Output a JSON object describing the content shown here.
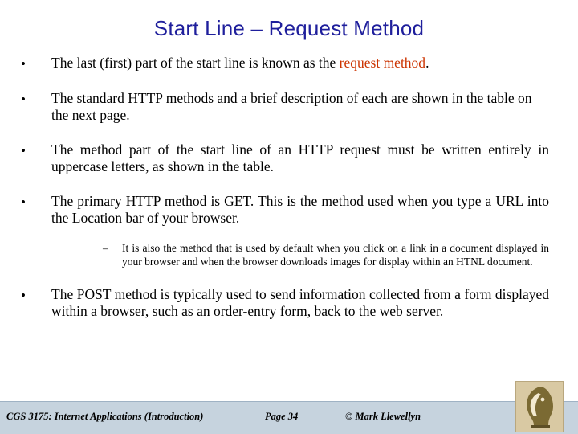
{
  "slide": {
    "title": "Start Line – Request Method",
    "bullets": [
      {
        "marker": "•",
        "pre": "The last (first) part of the start line is known as the ",
        "highlight": "request method",
        "post": "."
      },
      {
        "marker": "•",
        "pre": "The standard HTTP methods and a brief description of each are shown in the table on the next page.",
        "highlight": "",
        "post": ""
      },
      {
        "marker": "•",
        "pre": "The method part of the start line of an HTTP request must be written entirely in uppercase letters, as shown in the table.",
        "highlight": "",
        "post": ""
      },
      {
        "marker": "•",
        "pre": "The primary HTTP method is GET.  This is the method used when you type a URL into the Location bar of your browser.",
        "highlight": "",
        "post": ""
      },
      {
        "marker": "•",
        "pre": "The POST method is typically used to send information collected from a form displayed within a browser, such as an order-entry form, back to the web server.",
        "highlight": "",
        "post": ""
      }
    ],
    "subbullet": {
      "marker": "–",
      "text": "It is also the method that is used by default when you click on a link in a document displayed in your browser and when the browser downloads images for display within an HTNL document."
    }
  },
  "footer": {
    "left": "CGS 3175: Internet Applications (Introduction)",
    "center": "Page 34",
    "right": "© Mark Llewellyn",
    "logo_name": "knight-logo"
  },
  "colors": {
    "title": "#1f1f9c",
    "highlight": "#cc3300",
    "footer_bg": "#c6d3de",
    "logo_bg": "#d9c9a3"
  }
}
